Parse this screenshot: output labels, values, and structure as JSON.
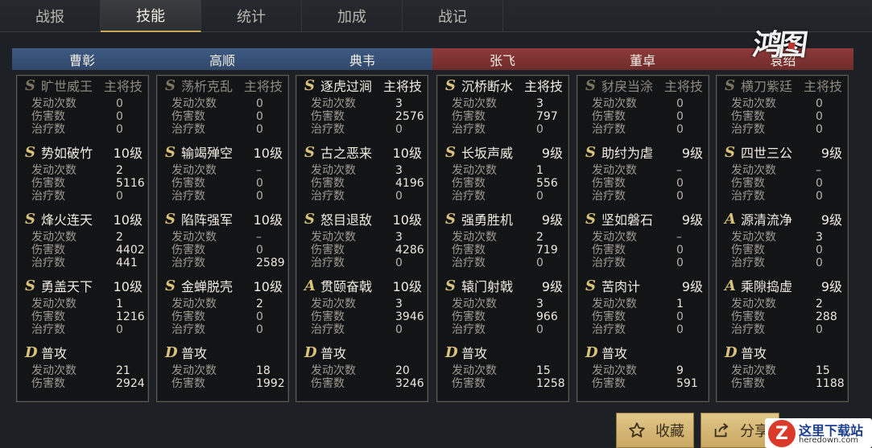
{
  "tabs": [
    "战报",
    "技能",
    "统计",
    "加成",
    "战记"
  ],
  "active_tab": 1,
  "logo": "鸿图",
  "heroes": [
    {
      "name": "曹彰",
      "faction": "wei",
      "skills": [
        {
          "grade": "S",
          "name": "旷世威王",
          "level": "主将技",
          "dim": true,
          "stats": [
            [
              "发动次数",
              "0"
            ],
            [
              "伤害数",
              "0"
            ],
            [
              "治疗数",
              "0"
            ]
          ]
        },
        {
          "grade": "S",
          "name": "势如破竹",
          "level": "10级",
          "dim": false,
          "stats": [
            [
              "发动次数",
              "2"
            ],
            [
              "伤害数",
              "5116"
            ],
            [
              "治疗数",
              "0"
            ]
          ]
        },
        {
          "grade": "S",
          "name": "烽火连天",
          "level": "10级",
          "dim": false,
          "stats": [
            [
              "发动次数",
              "2"
            ],
            [
              "伤害数",
              "4402"
            ],
            [
              "治疗数",
              "441"
            ]
          ]
        },
        {
          "grade": "S",
          "name": "勇盖天下",
          "level": "10级",
          "dim": false,
          "stats": [
            [
              "发动次数",
              "1"
            ],
            [
              "伤害数",
              "1216"
            ],
            [
              "治疗数",
              "0"
            ]
          ]
        },
        {
          "grade": "D",
          "name": "普攻",
          "level": "",
          "dim": false,
          "stats": [
            [
              "发动次数",
              "21"
            ],
            [
              "伤害数",
              "2924"
            ]
          ]
        }
      ]
    },
    {
      "name": "高顺",
      "faction": "wei",
      "skills": [
        {
          "grade": "S",
          "name": "荡析克乱",
          "level": "主将技",
          "dim": true,
          "stats": [
            [
              "发动次数",
              "0"
            ],
            [
              "伤害数",
              "0"
            ],
            [
              "治疗数",
              "0"
            ]
          ]
        },
        {
          "grade": "S",
          "name": "输竭殚空",
          "level": "10级",
          "dim": false,
          "stats": [
            [
              "发动次数",
              "–"
            ],
            [
              "伤害数",
              "0"
            ],
            [
              "治疗数",
              "0"
            ]
          ]
        },
        {
          "grade": "S",
          "name": "陷阵强军",
          "level": "10级",
          "dim": false,
          "stats": [
            [
              "发动次数",
              "–"
            ],
            [
              "伤害数",
              "0"
            ],
            [
              "治疗数",
              "2589"
            ]
          ]
        },
        {
          "grade": "S",
          "name": "金蝉脱壳",
          "level": "10级",
          "dim": false,
          "stats": [
            [
              "发动次数",
              "2"
            ],
            [
              "伤害数",
              "0"
            ],
            [
              "治疗数",
              "0"
            ]
          ]
        },
        {
          "grade": "D",
          "name": "普攻",
          "level": "",
          "dim": false,
          "stats": [
            [
              "发动次数",
              "18"
            ],
            [
              "伤害数",
              "1992"
            ]
          ]
        }
      ]
    },
    {
      "name": "典韦",
      "faction": "wei",
      "skills": [
        {
          "grade": "S",
          "name": "逐虎过涧",
          "level": "主将技",
          "dim": false,
          "stats": [
            [
              "发动次数",
              "3"
            ],
            [
              "伤害数",
              "2576"
            ],
            [
              "治疗数",
              "0"
            ]
          ]
        },
        {
          "grade": "S",
          "name": "古之恶来",
          "level": "10级",
          "dim": false,
          "stats": [
            [
              "发动次数",
              "3"
            ],
            [
              "伤害数",
              "4196"
            ],
            [
              "治疗数",
              "0"
            ]
          ]
        },
        {
          "grade": "S",
          "name": "怒目退敌",
          "level": "10级",
          "dim": false,
          "stats": [
            [
              "发动次数",
              "3"
            ],
            [
              "伤害数",
              "4286"
            ],
            [
              "治疗数",
              "0"
            ]
          ]
        },
        {
          "grade": "A",
          "name": "贯颐奋戟",
          "level": "10级",
          "dim": false,
          "stats": [
            [
              "发动次数",
              "3"
            ],
            [
              "伤害数",
              "3946"
            ],
            [
              "治疗数",
              "0"
            ]
          ]
        },
        {
          "grade": "D",
          "name": "普攻",
          "level": "",
          "dim": false,
          "stats": [
            [
              "发动次数",
              "20"
            ],
            [
              "伤害数",
              "3246"
            ]
          ]
        }
      ]
    },
    {
      "name": "张飞",
      "faction": "shu",
      "skills": [
        {
          "grade": "S",
          "name": "沉桥断水",
          "level": "主将技",
          "dim": false,
          "stats": [
            [
              "发动次数",
              "3"
            ],
            [
              "伤害数",
              "797"
            ],
            [
              "治疗数",
              "0"
            ]
          ]
        },
        {
          "grade": "S",
          "name": "长坂声威",
          "level": "9级",
          "dim": false,
          "stats": [
            [
              "发动次数",
              "1"
            ],
            [
              "伤害数",
              "556"
            ],
            [
              "治疗数",
              "0"
            ]
          ]
        },
        {
          "grade": "S",
          "name": "强勇胜机",
          "level": "9级",
          "dim": false,
          "stats": [
            [
              "发动次数",
              "2"
            ],
            [
              "伤害数",
              "719"
            ],
            [
              "治疗数",
              "0"
            ]
          ]
        },
        {
          "grade": "S",
          "name": "辕门射戟",
          "level": "9级",
          "dim": false,
          "stats": [
            [
              "发动次数",
              "3"
            ],
            [
              "伤害数",
              "966"
            ],
            [
              "治疗数",
              "0"
            ]
          ]
        },
        {
          "grade": "D",
          "name": "普攻",
          "level": "",
          "dim": false,
          "stats": [
            [
              "发动次数",
              "15"
            ],
            [
              "伤害数",
              "1258"
            ]
          ]
        }
      ]
    },
    {
      "name": "董卓",
      "faction": "shu",
      "skills": [
        {
          "grade": "S",
          "name": "豺戾当涂",
          "level": "主将技",
          "dim": true,
          "stats": [
            [
              "发动次数",
              "0"
            ],
            [
              "伤害数",
              "0"
            ],
            [
              "治疗数",
              "0"
            ]
          ]
        },
        {
          "grade": "S",
          "name": "助纣为虐",
          "level": "9级",
          "dim": false,
          "stats": [
            [
              "发动次数",
              "–"
            ],
            [
              "伤害数",
              "0"
            ],
            [
              "治疗数",
              "0"
            ]
          ]
        },
        {
          "grade": "S",
          "name": "坚如磐石",
          "level": "9级",
          "dim": false,
          "stats": [
            [
              "发动次数",
              "–"
            ],
            [
              "伤害数",
              "0"
            ],
            [
              "治疗数",
              "0"
            ]
          ]
        },
        {
          "grade": "S",
          "name": "苦肉计",
          "level": "9级",
          "dim": false,
          "stats": [
            [
              "发动次数",
              "1"
            ],
            [
              "伤害数",
              "0"
            ],
            [
              "治疗数",
              "0"
            ]
          ]
        },
        {
          "grade": "D",
          "name": "普攻",
          "level": "",
          "dim": false,
          "stats": [
            [
              "发动次数",
              "9"
            ],
            [
              "伤害数",
              "591"
            ]
          ]
        }
      ]
    },
    {
      "name": "袁绍",
      "faction": "shu",
      "skills": [
        {
          "grade": "S",
          "name": "横刀紫廷",
          "level": "主将技",
          "dim": true,
          "stats": [
            [
              "发动次数",
              "0"
            ],
            [
              "伤害数",
              "0"
            ],
            [
              "治疗数",
              "0"
            ]
          ]
        },
        {
          "grade": "S",
          "name": "四世三公",
          "level": "9级",
          "dim": false,
          "stats": [
            [
              "发动次数",
              "–"
            ],
            [
              "伤害数",
              "0"
            ],
            [
              "治疗数",
              "0"
            ]
          ]
        },
        {
          "grade": "A",
          "name": "源清流净",
          "level": "9级",
          "dim": false,
          "stats": [
            [
              "发动次数",
              "3"
            ],
            [
              "伤害数",
              "0"
            ],
            [
              "治疗数",
              "0"
            ]
          ]
        },
        {
          "grade": "A",
          "name": "乘隙捣虚",
          "level": "9级",
          "dim": false,
          "stats": [
            [
              "发动次数",
              "2"
            ],
            [
              "伤害数",
              "288"
            ],
            [
              "治疗数",
              "0"
            ]
          ]
        },
        {
          "grade": "D",
          "name": "普攻",
          "level": "",
          "dim": false,
          "stats": [
            [
              "发动次数",
              "15"
            ],
            [
              "伤害数",
              "1188"
            ]
          ]
        }
      ]
    }
  ],
  "buttons": {
    "favorite": "收藏",
    "share": "分享"
  },
  "watermark": {
    "badge": "Z",
    "text": "这里下载站",
    "url": "heredown.com"
  },
  "colors": {
    "wei": "#3d5a82",
    "shu": "#8e3a3a",
    "grade": "#d9c27a",
    "button": "#d6bb78"
  },
  "icons": {
    "favorite": "star-outline-icon",
    "share": "share-icon"
  }
}
